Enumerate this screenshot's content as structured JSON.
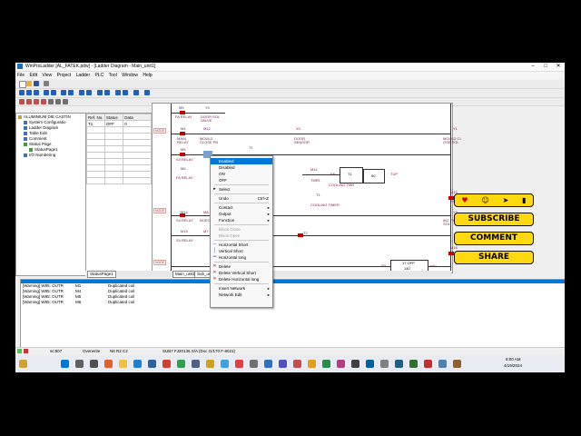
{
  "window": {
    "title": "WinProLadder [AL_FATEK.pdw] - [Ladder Diagram - Main_unit1]",
    "minimize_glyph": "–",
    "maximize_glyph": "□",
    "close_glyph": "✕"
  },
  "menubar": {
    "items": [
      "File",
      "Edit",
      "View",
      "Project",
      "Ladder",
      "PLC",
      "Tool",
      "Window",
      "Help"
    ]
  },
  "project_tree": {
    "items": [
      {
        "label": "ALUMINIUM DIE CASTIN",
        "indent": 0
      },
      {
        "label": "System Configuratio",
        "indent": 1
      },
      {
        "label": "Ladder Diagram",
        "indent": 1
      },
      {
        "label": "Table Edit",
        "indent": 1
      },
      {
        "label": "Comment",
        "indent": 1
      },
      {
        "label": "Status Page",
        "indent": 1
      },
      {
        "label": "StatusPage1",
        "indent": 2
      },
      {
        "label": "I/O Numbering",
        "indent": 1
      }
    ]
  },
  "status_grid": {
    "headers": [
      "Ref. No.",
      "Status",
      "Data"
    ],
    "rows": [
      [
        "T1",
        "OFF",
        "0"
      ]
    ]
  },
  "ladder": {
    "node_labels": [
      "NODE",
      "NODE",
      "NODE",
      "NODE"
    ],
    "labels": {
      "m5_top": "M5",
      "y0_top": "Y0",
      "fa_relay": "FA RELAY",
      "door_sol_valve": "DOOR SOL VALVE",
      "m4": "M4",
      "m12": "M12",
      "main_relay": "MAIN RELAY",
      "mould_close_pb": "MOULD CLOSE PB",
      "x0": "X0",
      "door_sensor": "DOOR SENSOR",
      "y1": "Y1",
      "mould_cl_ose_sol": "MOULD CL OSE SOL",
      "m5": "M5",
      "s4_relay": "S4 RELAY",
      "t1": "T1",
      "m6": "M6",
      "fa_relay2": "FA RELAY",
      "m11": "M11",
      "tmr1": "TMR1",
      "en": "EN",
      "t1_blk": "T1",
      "cooling_tmr": "COOLING TMR",
      "val_50": "50",
      "tup": "TUP",
      "t1_b": "T1",
      "cooling_tmr2": "COOLING TIMER",
      "m13": "M13",
      "tmr1_b": "TMR1",
      "y2": "Y2",
      "in_pis_ton_sol": "INJ. PIS TON SOL",
      "m14": "M14",
      "m8": "M8",
      "s4_relay2": "S4 RELAY",
      "injection": "INJECTION",
      "t2": "T2",
      "m15": "M15",
      "m7": "M7",
      "x1": "X1",
      "s4_relay3": "S4 RELAY",
      "m16": "M16",
      "s0": "S0",
      "val_140": "140",
      "unlo": "unlo",
      "n17_ofp": "17 OFP"
    }
  },
  "tabs": {
    "status_page": "StatusPage1",
    "main_unit1": "Main_unit1",
    "sub_unit1": "Sub_unit1"
  },
  "context_menu": {
    "items": [
      {
        "label": "Enabled",
        "state": "selected"
      },
      {
        "label": "Disabled",
        "state": "normal"
      },
      {
        "label": "ON",
        "state": "normal"
      },
      {
        "label": "OFF",
        "state": "normal"
      },
      {
        "sep": true
      },
      {
        "label": "Select",
        "state": "normal",
        "icon": "select"
      },
      {
        "sep": true
      },
      {
        "label": "Undo",
        "state": "normal",
        "shortcut": "Ctrl+Z"
      },
      {
        "sep": true
      },
      {
        "label": "Contact",
        "state": "normal",
        "arrow": true
      },
      {
        "label": "Output",
        "state": "normal",
        "arrow": true
      },
      {
        "label": "Function",
        "state": "normal",
        "arrow": true
      },
      {
        "sep": true
      },
      {
        "label": "Block Close",
        "state": "disabled"
      },
      {
        "label": "Block Open",
        "state": "disabled"
      },
      {
        "sep": true
      },
      {
        "label": "Horizontal Short",
        "state": "normal",
        "icon": "hshort"
      },
      {
        "label": "Vertical Short",
        "state": "normal",
        "icon": "vshort"
      },
      {
        "label": "Horizontal long",
        "state": "normal",
        "icon": "hlong"
      },
      {
        "sep": true
      },
      {
        "label": "Delete",
        "state": "normal",
        "icon": "x"
      },
      {
        "label": "Delete Vertical Short",
        "state": "normal",
        "icon": "x"
      },
      {
        "label": "Delete Horizontal long",
        "state": "normal",
        "icon": "x"
      },
      {
        "sep": true
      },
      {
        "label": "Insert Network",
        "state": "normal",
        "arrow": true
      },
      {
        "label": "Network Edit",
        "state": "normal",
        "arrow": true
      }
    ]
  },
  "output": {
    "rows": [
      {
        "msg": "[Warning] W85: OUTR",
        "ref": "M1",
        "desc": "Duplicated coil"
      },
      {
        "msg": "[Warning] W85: OUTR",
        "ref": "M4",
        "desc": "Duplicated coil"
      },
      {
        "msg": "[Warning] W85: OUTR",
        "ref": "M5",
        "desc": "Duplicated coil"
      },
      {
        "msg": "[Warning] W85: OUTR",
        "ref": "M6",
        "desc": "Duplicated coil"
      }
    ]
  },
  "statusbar": {
    "steps": "sc:507",
    "mode": "Overwrite",
    "position": "N6 R2 C2",
    "plc": "SUB7 FJ20136 S/A (Doc G/170 F-8021)"
  },
  "taskbar": {
    "time": "8:00 AM",
    "date": "4/19/2024"
  },
  "overlay": {
    "subscribe": "SUBSCRIBE",
    "comment": "COMMENT",
    "share": "SHARE",
    "icons": [
      "heart-icon",
      "chat-icon",
      "share-arrow-icon",
      "bookmark-icon"
    ]
  },
  "colors": {
    "accent": "#0078d7",
    "overlay_yellow": "#ffd90f",
    "ladder_text": "#7a1a4a",
    "contact_red": "#c00000"
  }
}
